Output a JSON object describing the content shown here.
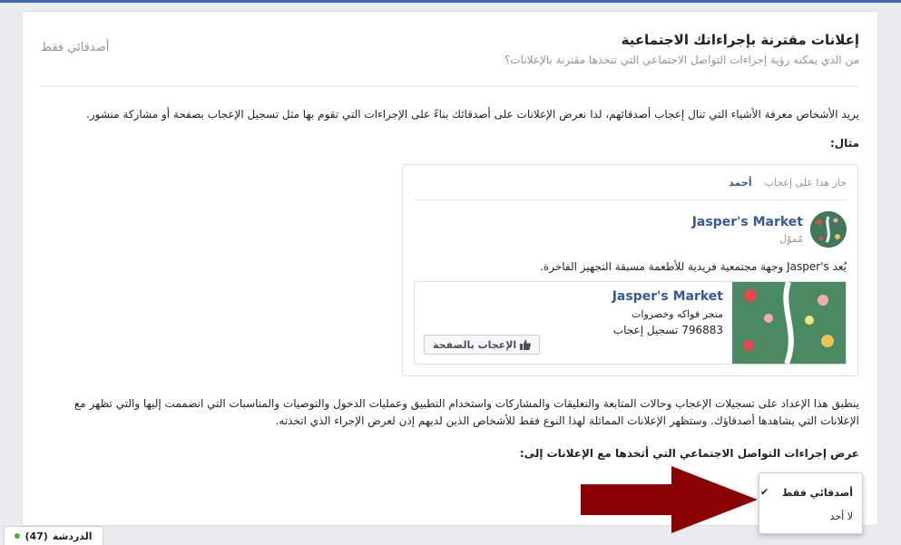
{
  "header": {
    "title": "إعلانات مقترنة بإجراءاتك الاجتماعية",
    "subtitle": "من الذي يمكنه رؤية إجراءات التواصل الاجتماعي التي تتخذها مقترنة بالإعلانات؟",
    "current_setting": "أصدقائي فقط"
  },
  "intro": "يريد الأشخاص معرفة الأشياء التي تنال إعجاب أصدقائهم، لذا نعرض الإعلانات على أصدقائك بناءً على الإجراءات التي تقوم بها مثل تسجيل الإعجاب بصفحة أو مشاركة منشور.",
  "example_label": "مثال:",
  "preview": {
    "social_context": "حاز هذا على إعجاب",
    "friend_name": "أحمد",
    "page_name": "Jasper's Market",
    "sponsored": "مُموّل",
    "post_text": "يُعد Jasper's وجهة مجتمعية فريدية للأطعمة مسبقة التجهيز الفاخرة.",
    "card": {
      "name": "Jasper's Market",
      "category": "متجر فواكه وخضروات",
      "likes_count": "796883",
      "likes_label": "تسجيل إعجاب",
      "like_button": "الإعجاب بالصفحة"
    }
  },
  "explain": "ينطبق هذا الإعداد على تسجيلات الإعجاب وحالات المتابعة والتعليقات والمشاركات واستخدام التطبيق وعمليات الدخول والتوصيات والمناسبات التي انضممت إليها والتي تظهر مع الإعلانات التي يشاهدها أصدقاؤك. وستظهر الإعلانات المماثلة لهذا النوع فقط للأشخاص الذين لديهم إذن لعرض الإجراء الذي اتخذته.",
  "question": "عرض إجراءات التواصل الاجتماعي التي أتخذها مع الإعلانات إلى:",
  "dropdown": {
    "options": [
      "أصدقائي فقط",
      "لا أحد"
    ],
    "selected": "أصدقائي فقط"
  },
  "chat": {
    "label": "الدردشة",
    "count": "(47)"
  },
  "colors": {
    "accent": "#365899",
    "arrow": "#8b0000",
    "online": "#42b72a"
  }
}
